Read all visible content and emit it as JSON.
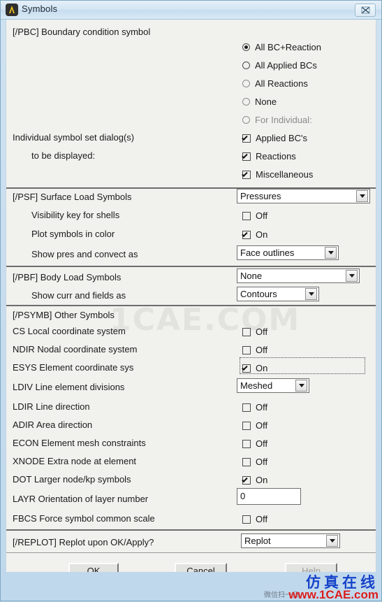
{
  "window": {
    "title": "Symbols",
    "logo_icon": "ansys-logo-icon",
    "close_icon": "close-icon"
  },
  "pbc": {
    "heading": "[/PBC] Boundary condition symbol",
    "individual_label_line1": "Individual symbol set dialog(s)",
    "individual_label_line2": "to be displayed:",
    "radios": [
      {
        "label": "All BC+Reaction",
        "selected": true,
        "enabled": true
      },
      {
        "label": "All Applied BCs",
        "selected": false,
        "enabled": true
      },
      {
        "label": "All Reactions",
        "selected": false,
        "enabled": true
      },
      {
        "label": "None",
        "selected": false,
        "enabled": true
      },
      {
        "label": "For Individual:",
        "selected": false,
        "enabled": false
      }
    ],
    "checkboxes": [
      {
        "label": "Applied BC's",
        "checked": true
      },
      {
        "label": "Reactions",
        "checked": true
      },
      {
        "label": "Miscellaneous",
        "checked": true
      }
    ]
  },
  "psf": {
    "heading": "[/PSF]  Surface Load Symbols",
    "heading_value": "Pressures",
    "rows": [
      {
        "label": "Visibility key for shells",
        "type": "checkbox",
        "checked": false,
        "value": "Off"
      },
      {
        "label": "Plot symbols in color",
        "type": "checkbox",
        "checked": true,
        "value": "On"
      },
      {
        "label": "Show pres and convect as",
        "type": "combo",
        "value": "Face outlines"
      }
    ]
  },
  "pbf": {
    "heading": "[/PBF]  Body Load Symbols",
    "heading_value": "None",
    "rows": [
      {
        "label": "Show curr and fields as",
        "type": "combo",
        "value": "Contours"
      }
    ]
  },
  "psymb": {
    "heading": "[/PSYMB] Other Symbols",
    "rows": [
      {
        "label": "CS   Local coordinate system",
        "type": "checkbox",
        "checked": false,
        "value": "Off",
        "focused": false
      },
      {
        "label": "NDIR Nodal coordinate system",
        "type": "checkbox",
        "checked": false,
        "value": "Off",
        "focused": false
      },
      {
        "label": "ESYS Element coordinate sys",
        "type": "checkbox",
        "checked": true,
        "value": "On",
        "focused": true
      },
      {
        "label": "LDIV  Line element divisions",
        "type": "combo",
        "value": "Meshed",
        "focused": false
      },
      {
        "label": "LDIR Line direction",
        "type": "checkbox",
        "checked": false,
        "value": "Off",
        "focused": false
      },
      {
        "label": "ADIR Area direction",
        "type": "checkbox",
        "checked": false,
        "value": "Off",
        "focused": false
      },
      {
        "label": "ECON Element mesh constraints",
        "type": "checkbox",
        "checked": false,
        "value": "Off",
        "focused": false
      },
      {
        "label": "XNODE Extra node at element",
        "type": "checkbox",
        "checked": false,
        "value": "Off",
        "focused": false
      },
      {
        "label": "DOT  Larger node/kp symbols",
        "type": "checkbox",
        "checked": true,
        "value": "On",
        "focused": false
      },
      {
        "label": "LAYR Orientation of layer number",
        "type": "input",
        "value": "0",
        "focused": false
      },
      {
        "label": "FBCS Force symbol common scale",
        "type": "checkbox",
        "checked": false,
        "value": "Off",
        "focused": false
      }
    ]
  },
  "replot": {
    "heading": "[/REPLOT] Replot upon OK/Apply?",
    "value": "Replot"
  },
  "buttons": {
    "ok": "OK",
    "cancel": "Cancel",
    "help": "Help"
  },
  "watermark": {
    "faint": "1CAE.COM",
    "chinese": "仿真在线",
    "url_www": "www.",
    "url_domain": "1CAE.com",
    "qr_caption": "微信扫一扫"
  }
}
